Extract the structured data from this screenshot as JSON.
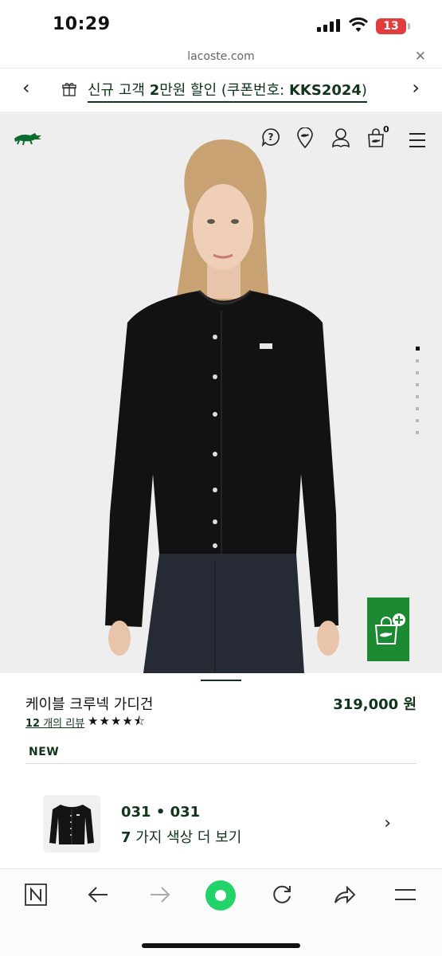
{
  "status_bar": {
    "time": "10:29",
    "battery": "13"
  },
  "browser": {
    "url": "lacoste.com"
  },
  "promo": {
    "prefix": "신규 고객 ",
    "amount": "2",
    "middle": "만원 할인 (쿠폰번호: ",
    "code": "KKS2024",
    "suffix": ")"
  },
  "header": {
    "cart_count": "0"
  },
  "gallery": {
    "image_count": 8,
    "active_index": 0
  },
  "product": {
    "title": "케이블 크루넥 가디건",
    "price": "319,000 원",
    "review_num": "12",
    "review_text": " 개의 리뷰",
    "rating": 4.5,
    "stars": "★★★★⯪",
    "badge": "NEW"
  },
  "colors": {
    "code": "031 • 031",
    "count": "7",
    "more_text": " 가지 색상 더 보기"
  },
  "toolbar": {
    "icons": [
      "naver-icon",
      "back-arrow-icon",
      "forward-arrow-icon",
      "home-green-icon",
      "reload-icon",
      "share-icon",
      "menu-icon"
    ]
  },
  "theme": {
    "brand_green": "#11341c",
    "accent_green": "#1c8a32",
    "battery_red": "#e23d3d"
  }
}
